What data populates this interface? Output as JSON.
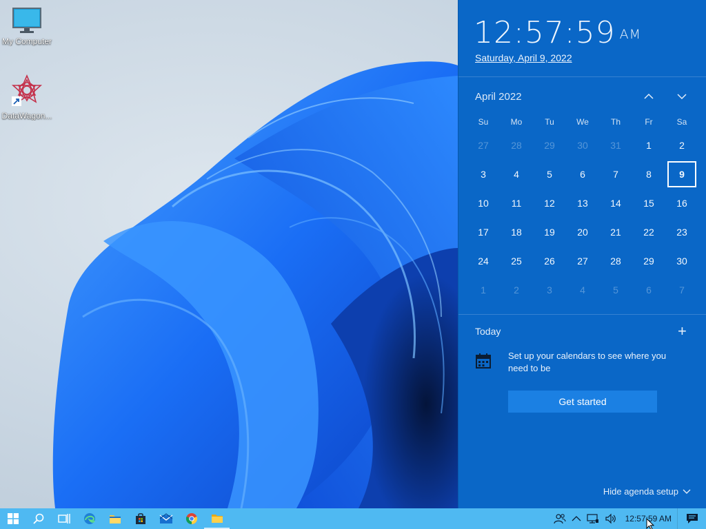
{
  "desktop": {
    "icons": [
      {
        "label": "My Computer",
        "icon": "computer-monitor-icon"
      },
      {
        "label": "DataWagon...",
        "icon": "datawagon-app-icon"
      }
    ]
  },
  "flyout": {
    "time": "12:57:59",
    "ampm": "AM",
    "long_date": "Saturday, April 9, 2022",
    "month_title": "April 2022",
    "weekdays": [
      "Su",
      "Mo",
      "Tu",
      "We",
      "Th",
      "Fr",
      "Sa"
    ],
    "weeks": [
      [
        {
          "d": "27",
          "m": "prev"
        },
        {
          "d": "28",
          "m": "prev"
        },
        {
          "d": "29",
          "m": "prev"
        },
        {
          "d": "30",
          "m": "prev"
        },
        {
          "d": "31",
          "m": "prev"
        },
        {
          "d": "1",
          "m": "cur"
        },
        {
          "d": "2",
          "m": "cur"
        }
      ],
      [
        {
          "d": "3",
          "m": "cur"
        },
        {
          "d": "4",
          "m": "cur"
        },
        {
          "d": "5",
          "m": "cur"
        },
        {
          "d": "6",
          "m": "cur"
        },
        {
          "d": "7",
          "m": "cur"
        },
        {
          "d": "8",
          "m": "cur"
        },
        {
          "d": "9",
          "m": "today"
        }
      ],
      [
        {
          "d": "10",
          "m": "cur"
        },
        {
          "d": "11",
          "m": "cur"
        },
        {
          "d": "12",
          "m": "cur"
        },
        {
          "d": "13",
          "m": "cur"
        },
        {
          "d": "14",
          "m": "cur"
        },
        {
          "d": "15",
          "m": "cur"
        },
        {
          "d": "16",
          "m": "cur"
        }
      ],
      [
        {
          "d": "17",
          "m": "cur"
        },
        {
          "d": "18",
          "m": "cur"
        },
        {
          "d": "19",
          "m": "cur"
        },
        {
          "d": "20",
          "m": "cur"
        },
        {
          "d": "21",
          "m": "cur"
        },
        {
          "d": "22",
          "m": "cur"
        },
        {
          "d": "23",
          "m": "cur"
        }
      ],
      [
        {
          "d": "24",
          "m": "cur"
        },
        {
          "d": "25",
          "m": "cur"
        },
        {
          "d": "26",
          "m": "cur"
        },
        {
          "d": "27",
          "m": "cur"
        },
        {
          "d": "28",
          "m": "cur"
        },
        {
          "d": "29",
          "m": "cur"
        },
        {
          "d": "30",
          "m": "cur"
        }
      ],
      [
        {
          "d": "1",
          "m": "next"
        },
        {
          "d": "2",
          "m": "next"
        },
        {
          "d": "3",
          "m": "next"
        },
        {
          "d": "4",
          "m": "next"
        },
        {
          "d": "5",
          "m": "next"
        },
        {
          "d": "6",
          "m": "next"
        },
        {
          "d": "7",
          "m": "next"
        }
      ]
    ],
    "agenda": {
      "title": "Today",
      "add": "+",
      "message": "Set up your calendars to see where you need to be",
      "button": "Get started",
      "hide_link": "Hide agenda setup"
    }
  },
  "taskbar": {
    "buttons": [
      "start-windows-icon",
      "search-icon",
      "task-view-icon",
      "edge-browser-icon",
      "file-explorer-icon",
      "store-icon",
      "mail-icon",
      "chrome-icon",
      "folder-icon"
    ],
    "tray_icons": [
      "people-icon",
      "chevron-up-icon",
      "network-icon",
      "speaker-icon",
      "action-center-icon"
    ],
    "clock": "12:57:59 AM"
  },
  "colors": {
    "flyout_bg": "#0a67c7",
    "taskbar_bg": "#4fb9f2",
    "button_bg": "#1b80e3"
  }
}
